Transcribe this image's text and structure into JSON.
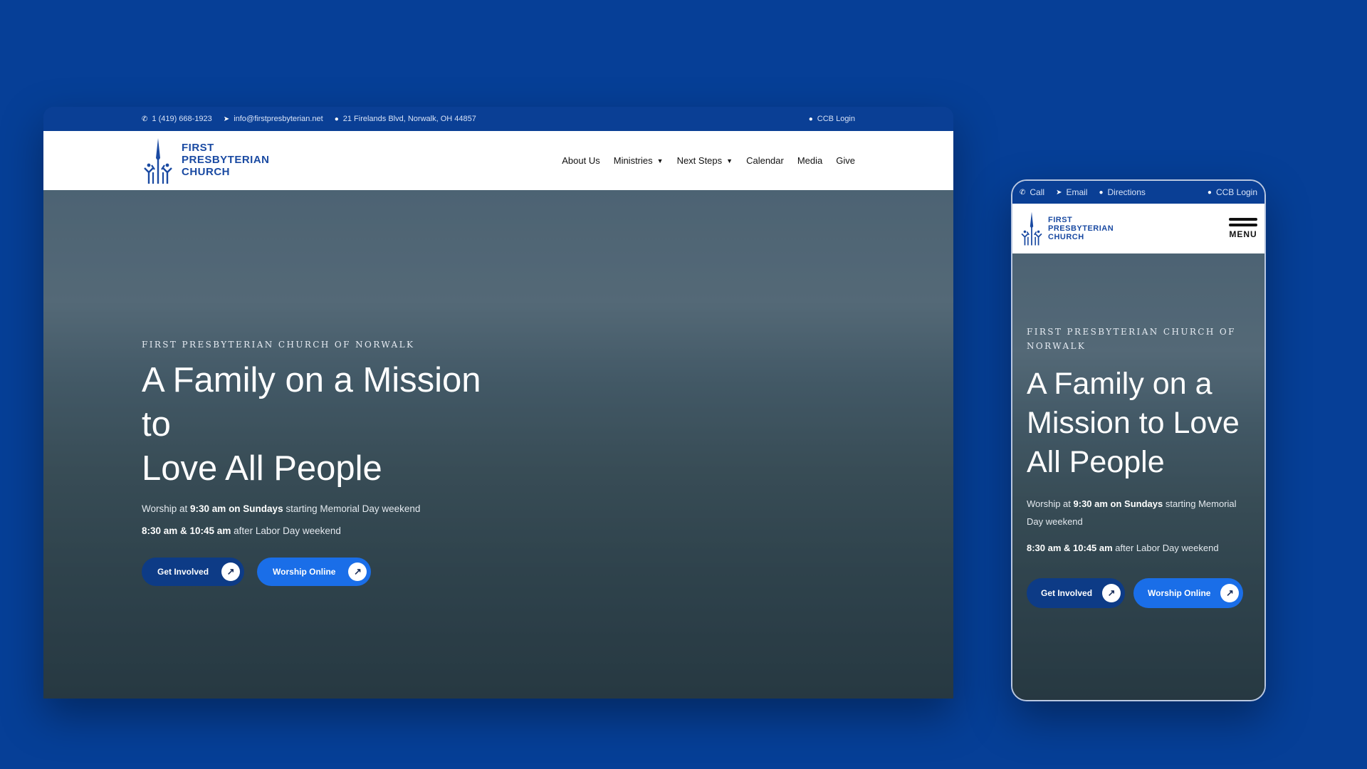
{
  "desktop": {
    "topbar": {
      "phone": "1 (419) 668-1923",
      "email": "info@firstpresbyterian.net",
      "address": "21 Firelands Blvd, Norwalk, OH 44857",
      "login": "CCB Login"
    },
    "logo": {
      "line1": "FIRST",
      "line2": "PRESBYTERIAN",
      "line3": "CHURCH"
    },
    "nav": {
      "about": "About Us",
      "ministries": "Ministries",
      "next_steps": "Next Steps",
      "calendar": "Calendar",
      "media": "Media",
      "give": "Give"
    },
    "hero": {
      "eyebrow": "FIRST PRESBYTERIAN CHURCH OF NORWALK",
      "title_line1": "A Family on a Mission to",
      "title_line2": "Love All People",
      "worship_prefix": "Worship at ",
      "worship_bold": "9:30 am on Sundays",
      "worship_suffix": " starting Memorial Day weekend",
      "labor_bold": "8:30 am & 10:45 am",
      "labor_suffix": " after Labor Day weekend",
      "btn_involved": "Get Involved",
      "btn_worship": "Worship Online"
    }
  },
  "mobile": {
    "topbar": {
      "call": "Call",
      "email": "Email",
      "directions": "Directions",
      "login": "CCB Login"
    },
    "logo": {
      "line1": "FIRST",
      "line2": "PRESBYTERIAN",
      "line3": "CHURCH"
    },
    "menu_label": "MENU",
    "hero": {
      "eyebrow": "FIRST PRESBYTERIAN CHURCH OF NORWALK",
      "title_line1": "A Family on a",
      "title_line2": "Mission to Love",
      "title_line3": "All People",
      "worship_prefix": "Worship at ",
      "worship_bold": "9:30 am on Sundays",
      "worship_suffix": " starting Memorial Day weekend",
      "labor_bold": "8:30 am & 10:45 am",
      "labor_suffix": " after Labor Day weekend",
      "btn_involved": "Get Involved",
      "btn_worship": "Worship Online"
    }
  },
  "icons": {
    "phone": "phone-icon",
    "send": "send-icon",
    "pin": "map-pin-icon",
    "shield": "lock-icon",
    "arrow": "arrow-up-right-icon",
    "caret": "chevron-down-icon",
    "menu": "hamburger-icon"
  },
  "colors": {
    "background": "#063f97",
    "topbar": "#0a3f95",
    "brand_blue": "#1a4aa2",
    "btn_dark": "#0d3b86",
    "btn_blue": "#1a6ee8"
  }
}
